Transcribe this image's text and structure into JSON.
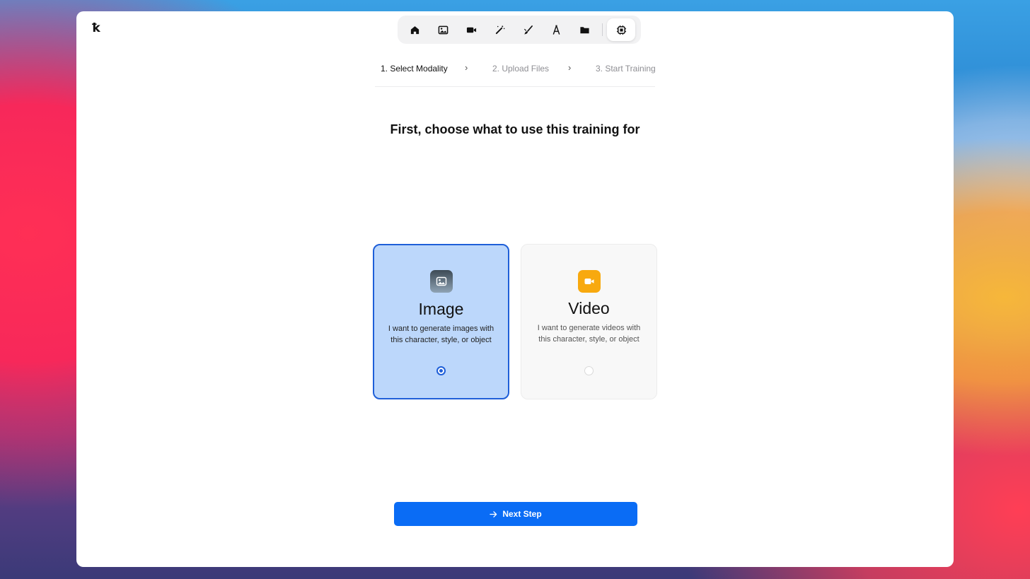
{
  "app": {
    "logo_text": "ꝁ"
  },
  "toolbar": {
    "items": [
      {
        "icon": "home-icon"
      },
      {
        "icon": "image-icon"
      },
      {
        "icon": "video-icon"
      },
      {
        "icon": "magic-wand-icon"
      },
      {
        "icon": "brush-icon"
      },
      {
        "icon": "font-icon"
      },
      {
        "icon": "folder-icon"
      },
      {
        "icon": "chip-icon",
        "active": true
      }
    ]
  },
  "steps": [
    {
      "label": "1. Select Modality",
      "active": true
    },
    {
      "label": "2. Upload Files",
      "active": false
    },
    {
      "label": "3. Start Training",
      "active": false
    }
  ],
  "step_separator": "›",
  "heading": "First, choose what to use this training for",
  "options": [
    {
      "title": "Image",
      "description": "I want to generate images with this character, style, or object",
      "selected": true,
      "icon": "image-icon"
    },
    {
      "title": "Video",
      "description": "I want to generate videos with this character, style, or object",
      "selected": false,
      "icon": "video-icon"
    }
  ],
  "next_button": {
    "label": "Next Step",
    "icon": "arrow-right-icon"
  },
  "colors": {
    "accent": "#0a6cf5",
    "selected_border": "#1f5fd8",
    "selected_bg": "#bcd7fb",
    "video_icon_bg": "#f8a90f"
  }
}
